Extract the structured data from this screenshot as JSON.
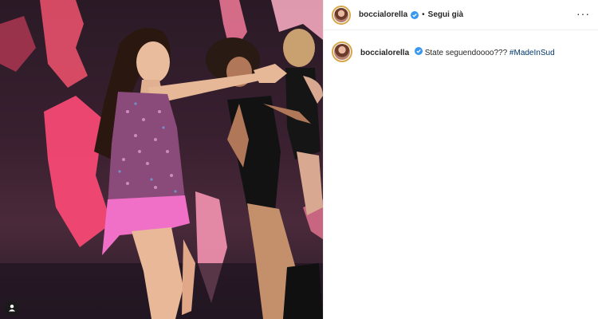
{
  "post": {
    "photo": {
      "alt_icon": "user-tag-icon"
    },
    "header": {
      "username": "boccialorella",
      "separator": "•",
      "follow_label": "Segui già",
      "more_label": "···"
    },
    "caption": {
      "username": "boccialorella",
      "text": "State seguendoooo???",
      "hashtag": "#MadeInSud"
    },
    "colors": {
      "verified_blue": "#3897f0",
      "hashtag": "#00376b",
      "avatar_ring": "#d8a64a"
    }
  }
}
